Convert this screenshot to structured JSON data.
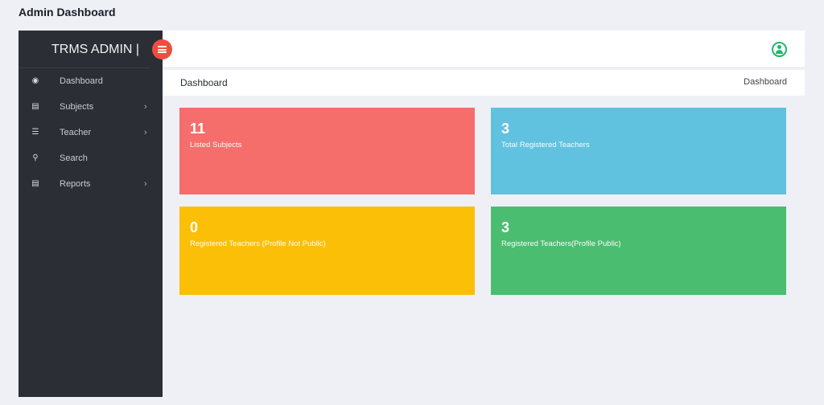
{
  "page": {
    "title": "Admin Dashboard"
  },
  "sidebar": {
    "brand": "TRMS ADMIN |",
    "items": [
      {
        "label": "Dashboard",
        "icon": "dashboard-icon",
        "has_submenu": false
      },
      {
        "label": "Subjects",
        "icon": "list-icon",
        "has_submenu": true
      },
      {
        "label": "Teacher",
        "icon": "list-icon",
        "has_submenu": true
      },
      {
        "label": "Search",
        "icon": "search-icon",
        "has_submenu": false
      },
      {
        "label": "Reports",
        "icon": "list-icon",
        "has_submenu": true
      }
    ]
  },
  "header": {
    "user_icon": "user-circle-icon",
    "toggle_icon": "menu-toggle-icon"
  },
  "breadcrumb": {
    "title": "Dashboard",
    "crumb": "Dashboard"
  },
  "cards": [
    {
      "value": "11",
      "label": "Listed Subjects",
      "color": "#f56e6c"
    },
    {
      "value": "3",
      "label": "Total Registered Teachers",
      "color": "#61c2df"
    },
    {
      "value": "0",
      "label": "Registered Teachers (Profile Not Public)",
      "color": "#fcbf07"
    },
    {
      "value": "3",
      "label": "Registered Teachers(Profile Public)",
      "color": "#4bbd70"
    }
  ]
}
